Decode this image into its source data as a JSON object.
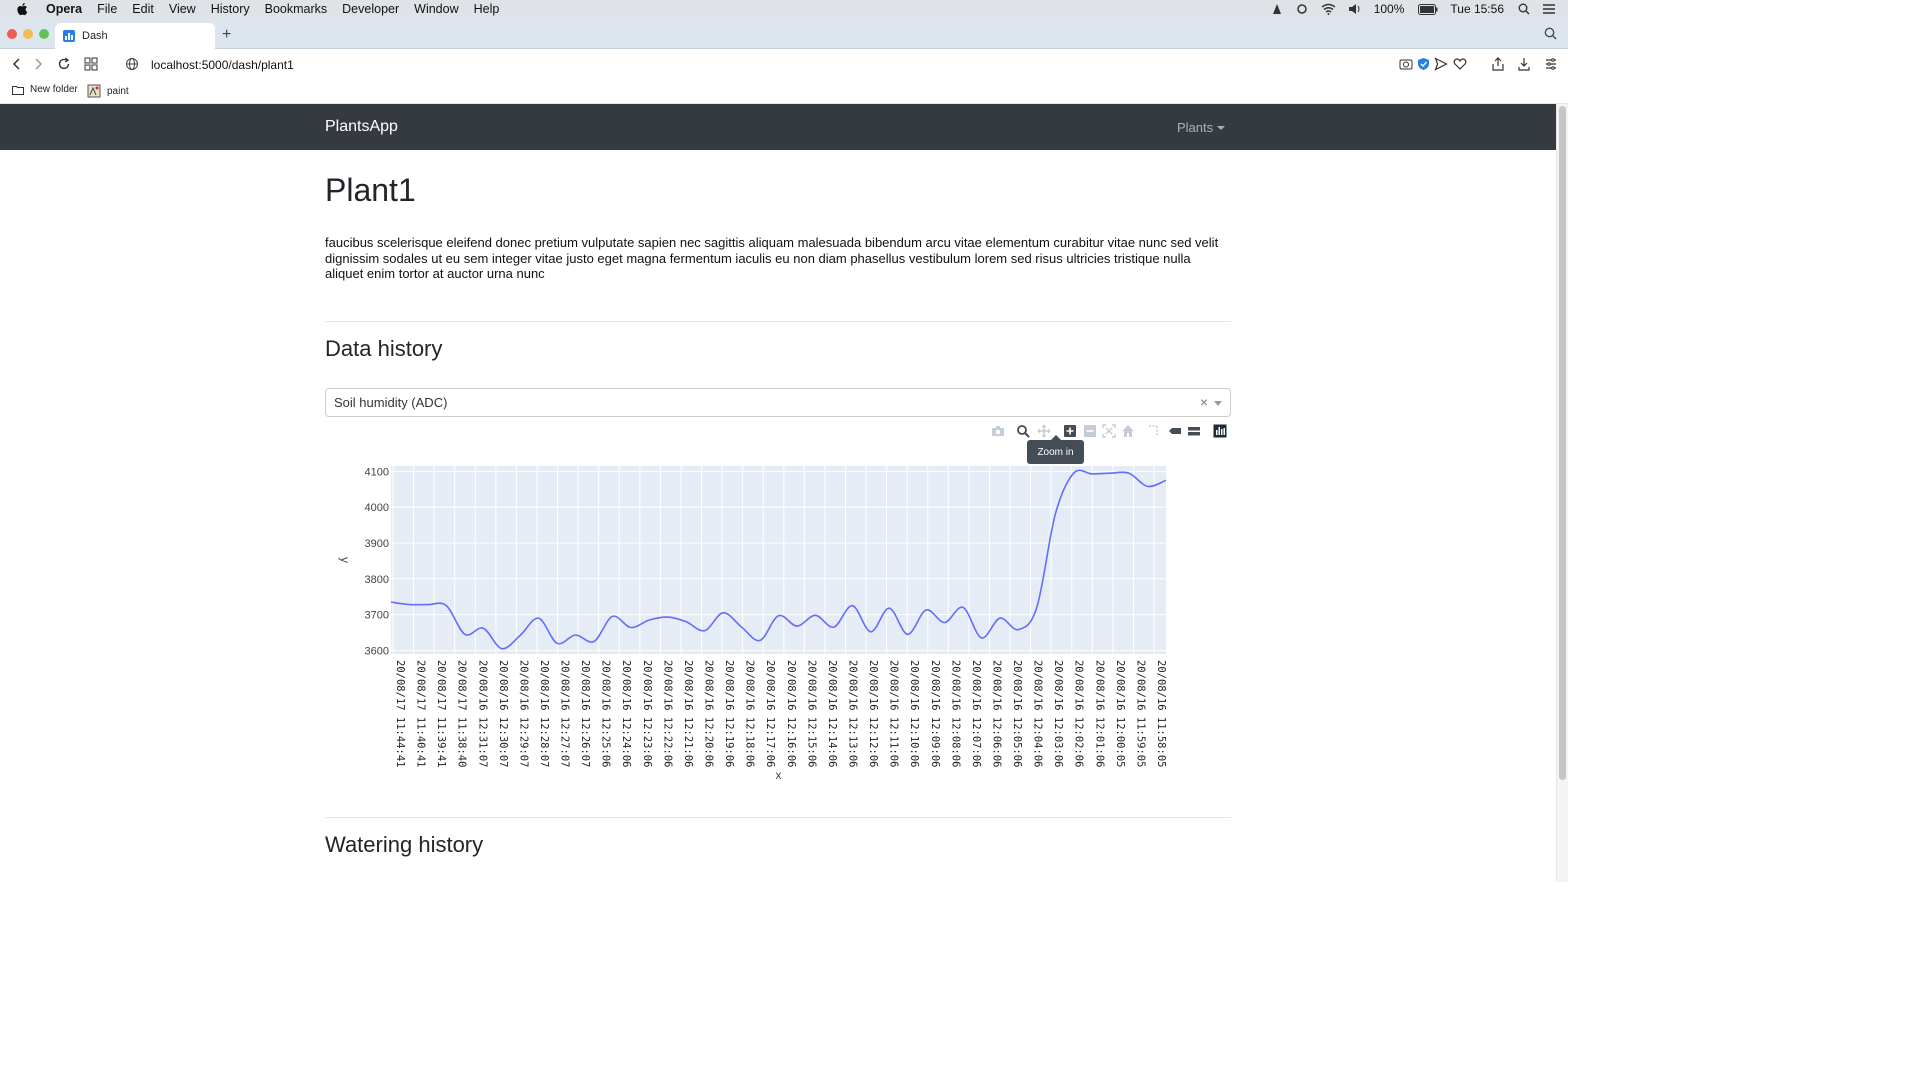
{
  "os_menubar": {
    "app_name": "Opera",
    "items": [
      "File",
      "Edit",
      "View",
      "History",
      "Bookmarks",
      "Developer",
      "Window",
      "Help"
    ],
    "battery": "100%",
    "clock": "Tue 15:56"
  },
  "browser": {
    "tab_title": "Dash",
    "url": "localhost:5000/dash/plant1",
    "bookmarks": [
      "New folder",
      "paint"
    ]
  },
  "app": {
    "brand": "PlantsApp",
    "nav_dropdown": "Plants"
  },
  "page": {
    "title": "Plant1",
    "description": "faucibus scelerisque eleifend donec pretium vulputate sapien nec sagittis aliquam malesuada bibendum arcu vitae elementum curabitur vitae nunc sed velit dignissim sodales ut eu sem integer vitae justo eget magna fermentum iaculis eu non diam phasellus vestibulum lorem sed risus ultricies tristique nulla aliquet enim tortor at auctor urna nunc",
    "data_history_heading": "Data history",
    "selected_metric": "Soil humidity (ADC)",
    "watering_history_heading": "Watering history"
  },
  "modebar": {
    "tooltip": "Zoom in",
    "buttons": [
      "camera-icon",
      "zoom-icon",
      "pan-icon",
      "zoom-in-icon",
      "zoom-out-icon",
      "autoscale-icon",
      "reset-axes-icon",
      "spike-lines-icon",
      "hover-closest-icon",
      "hover-compare-icon",
      "plotly-logo-icon"
    ]
  },
  "chart_data": {
    "type": "line",
    "xlabel": "x",
    "ylabel": "y",
    "ylim": [
      3590,
      4115
    ],
    "yticks": [
      3600,
      3700,
      3800,
      3900,
      4000,
      4100
    ],
    "grid": true,
    "line_color": "#636efa",
    "categories": [
      "20/08/17 11:44:41",
      "20/08/17 11:40:41",
      "20/08/17 11:39:41",
      "20/08/17 11:38:40",
      "20/08/16 12:31:07",
      "20/08/16 12:30:07",
      "20/08/16 12:29:07",
      "20/08/16 12:28:07",
      "20/08/16 12:27:07",
      "20/08/16 12:26:07",
      "20/08/16 12:25:06",
      "20/08/16 12:24:06",
      "20/08/16 12:23:06",
      "20/08/16 12:22:06",
      "20/08/16 12:21:06",
      "20/08/16 12:20:06",
      "20/08/16 12:19:06",
      "20/08/16 12:18:06",
      "20/08/16 12:17:06",
      "20/08/16 12:16:06",
      "20/08/16 12:15:06",
      "20/08/16 12:14:06",
      "20/08/16 12:13:06",
      "20/08/16 12:12:06",
      "20/08/16 12:11:06",
      "20/08/16 12:10:06",
      "20/08/16 12:09:06",
      "20/08/16 12:08:06",
      "20/08/16 12:07:06",
      "20/08/16 12:06:06",
      "20/08/16 12:05:06",
      "20/08/16 12:04:06",
      "20/08/16 12:03:06",
      "20/08/16 12:02:06",
      "20/08/16 12:01:06",
      "20/08/16 12:00:05",
      "20/08/16 11:59:05",
      "20/08/16 11:58:05"
    ],
    "values": [
      3735,
      3728,
      3728,
      3725,
      3645,
      3662,
      3605,
      3642,
      3690,
      3620,
      3643,
      3625,
      3695,
      3664,
      3685,
      3693,
      3680,
      3655,
      3705,
      3665,
      3628,
      3697,
      3668,
      3698,
      3665,
      3725,
      3652,
      3718,
      3645,
      3713,
      3678,
      3720,
      3635,
      3690,
      3658,
      3720,
      3980,
      4095,
      4093,
      4095,
      4095,
      4058,
      4075
    ]
  }
}
